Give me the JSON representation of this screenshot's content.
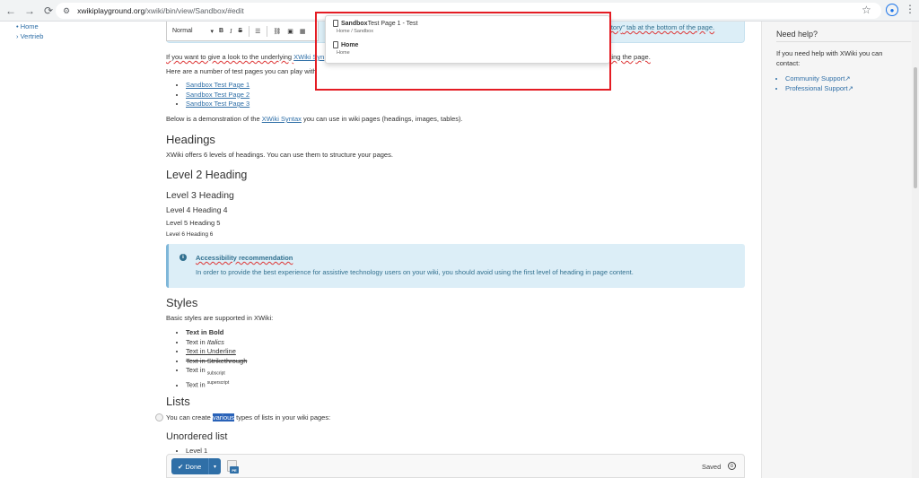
{
  "browser": {
    "back_icon": "←",
    "forward_icon": "→",
    "reload_icon": "⟳",
    "url_host": "xwikiplayground.org",
    "url_path": "/xwiki/bin/view/Sandbox/#edit"
  },
  "left_nav": {
    "items": [
      "• Home",
      "› Vertrieb"
    ]
  },
  "toolbar": {
    "format_value": "Normal",
    "bold": "B",
    "italic": "I",
    "strike": "S"
  },
  "notice": {
    "link_text": "History",
    "suffix": "\" tab at the bottom of the page."
  },
  "content": {
    "p1_prefix": "If you want to give a look to the underlying ",
    "p1_link": "XWiki Syn",
    "p1_suffix": "ting the page.",
    "p2": "Here are a number of test pages you can play with",
    "test_pages": [
      "Sandbox Test Page 1",
      "Sandbox Test Page 2",
      "Sandbox Test Page 3"
    ],
    "p3_prefix": "Below is a demonstration of the ",
    "p3_link": "XWiki Syntax",
    "p3_suffix": " you can use in wiki pages (headings, images, tables).",
    "h_headings": "Headings",
    "p_headings": "XWiki offers 6 levels of headings. You can use them to structure your pages.",
    "h2": "Level 2 Heading",
    "h3": "Level 3 Heading",
    "h4": "Level 4 Heading 4",
    "h5": "Level 5 Heading 5",
    "h6": "Level 6 Heading 6",
    "access_title": "Accessibility recommendation",
    "access_text": "In order to provide the best experience for assistive technology users on your wiki, you should avoid using the first level of heading in page content.",
    "h_styles": "Styles",
    "p_styles": "Basic styles are supported in XWiki:",
    "style_bold": "Text in Bold",
    "style_italic_prefix": "Text in ",
    "style_italic": "Italics",
    "style_underline": "Text in Underline",
    "style_strike": "Text in Strikethrough",
    "style_sub_prefix": "Text in ",
    "style_sub": "subscript",
    "style_sup_prefix": "Text in ",
    "style_sup": "superscript",
    "h_lists": "Lists",
    "p_lists_prefix": "You can create ",
    "p_lists_sel": "various",
    "p_lists_suffix": " types of lists in your wiki pages:",
    "h_unordered": "Unordered list",
    "list_level1": "Level 1"
  },
  "popup": {
    "item1_bold": "Sandbox",
    "item1_rest": " Test Page 1 - Test",
    "item1_path": "Home / Sandbox",
    "item2_title": "Home",
    "item2_path": "Home"
  },
  "sidebar": {
    "title": "Need help?",
    "text": "If you need help with XWiki you can contact:",
    "links": [
      "Community Support↗",
      "Professional Support↗"
    ]
  },
  "bottom_bar": {
    "done_label": "✔ Done",
    "caret": "▾",
    "pe_badge": "PE",
    "saved_label": "Saved",
    "history_icon_glyph": "⏲"
  },
  "colors": {
    "accent": "#2f6fa7",
    "highlight_box": "#e41c24",
    "info_bg": "#dceef7"
  }
}
